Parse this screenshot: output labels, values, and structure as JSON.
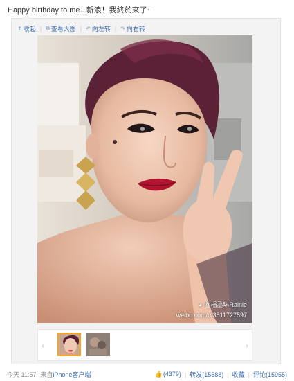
{
  "post": {
    "text": "Happy birthday to me...新浪！我終於來了~"
  },
  "toolbar": {
    "collapse": {
      "icon": "↥",
      "label": "收起"
    },
    "view_large": {
      "icon": "⧉",
      "label": "查看大图"
    },
    "rotate_left": {
      "icon": "↶",
      "label": "向左转"
    },
    "rotate_right": {
      "icon": "↷",
      "label": "向右转"
    }
  },
  "photo": {
    "watermark_handle": "@楊丞琳Rainie",
    "watermark_url": "weibo.com/u/3511727597"
  },
  "thumbnails": {
    "prev": "‹",
    "next": "›"
  },
  "footer": {
    "time": "今天 11:57",
    "source_prefix": "来自",
    "source": "iPhone客户端",
    "like_count": "(4379)",
    "repost": "转发(15588)",
    "favorite": "收藏",
    "comment": "评论(15955)"
  }
}
